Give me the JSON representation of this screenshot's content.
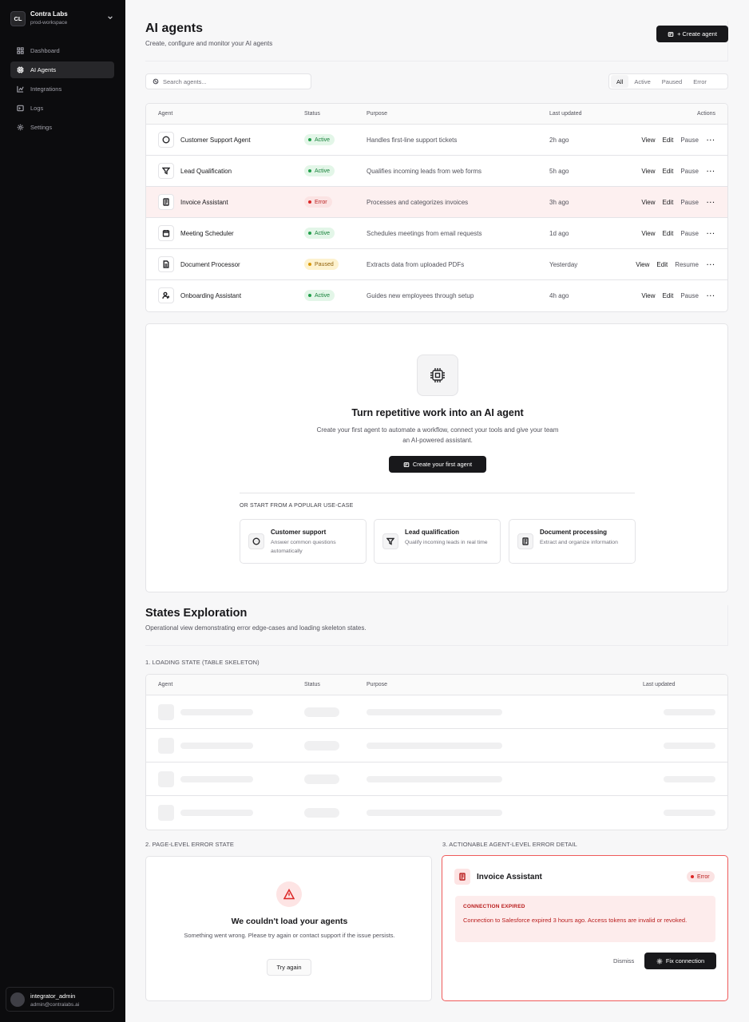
{
  "workspace": {
    "initials": "CL",
    "name": "Contra Labs",
    "subtitle": "prod-workspace"
  },
  "nav": [
    {
      "label": "Dashboard",
      "icon": "grid-icon"
    },
    {
      "label": "AI Agents",
      "icon": "chip-icon",
      "active": true
    },
    {
      "label": "Integrations",
      "icon": "chart-icon"
    },
    {
      "label": "Logs",
      "icon": "terminal-icon"
    },
    {
      "label": "Settings",
      "icon": "gear-icon"
    }
  ],
  "user": {
    "name": "integrator_admin",
    "email": "admin@contralabs.ai"
  },
  "header": {
    "title": "AI agents",
    "subtitle": "Create, configure and monitor your AI agents",
    "create_label": "+ Create agent"
  },
  "search": {
    "placeholder": "Search agents..."
  },
  "filters": [
    "All",
    "Active",
    "Paused",
    "Error"
  ],
  "table": {
    "columns": [
      "Agent",
      "Status",
      "Purpose",
      "Last updated",
      "Actions"
    ],
    "rows": [
      {
        "name": "Customer Support Agent",
        "icon": "chat-icon",
        "status": "Active",
        "purpose": "Handles first-line support tickets",
        "updated": "2h ago",
        "actions": [
          "View",
          "Edit",
          "Pause"
        ]
      },
      {
        "name": "Lead Qualification",
        "icon": "funnel-icon",
        "status": "Active",
        "purpose": "Qualifies incoming leads from web forms",
        "updated": "5h ago",
        "actions": [
          "View",
          "Edit",
          "Pause"
        ]
      },
      {
        "name": "Invoice Assistant",
        "icon": "invoice-icon",
        "status": "Error",
        "purpose": "Processes and categorizes invoices",
        "updated": "3h ago",
        "actions": [
          "View",
          "Edit",
          "Pause"
        ]
      },
      {
        "name": "Meeting Scheduler",
        "icon": "calendar-icon",
        "status": "Active",
        "purpose": "Schedules meetings from email requests",
        "updated": "1d ago",
        "actions": [
          "View",
          "Edit",
          "Pause"
        ]
      },
      {
        "name": "Document Processor",
        "icon": "document-icon",
        "status": "Paused",
        "purpose": "Extracts data from uploaded PDFs",
        "updated": "Yesterday",
        "actions": [
          "View",
          "Edit",
          "Resume"
        ]
      },
      {
        "name": "Onboarding Assistant",
        "icon": "user-plus-icon",
        "status": "Active",
        "purpose": "Guides new employees through setup",
        "updated": "4h ago",
        "actions": [
          "View",
          "Edit",
          "Pause"
        ]
      }
    ]
  },
  "empty_state": {
    "title": "Turn repetitive work into an AI agent",
    "description": "Create your first agent to automate a workflow, connect your tools and give your team an AI-powered assistant.",
    "button": "Create your first agent",
    "or_label": "OR START FROM A POPULAR USE-CASE",
    "use_cases": [
      {
        "title": "Customer support",
        "description": "Answer common questions automatically",
        "icon": "chat-icon"
      },
      {
        "title": "Lead qualification",
        "description": "Qualify incoming leads in real time",
        "icon": "funnel-icon"
      },
      {
        "title": "Document processing",
        "description": "Extract and organize information",
        "icon": "invoice-icon"
      }
    ]
  },
  "states": {
    "title": "States Exploration",
    "subtitle": "Operational view demonstrating error edge-cases and loading skeleton states.",
    "loading_label": "1. LOADING STATE (TABLE SKELETON)",
    "skeleton_columns": [
      "Agent",
      "Status",
      "Purpose",
      "Last updated"
    ],
    "page_error_label": "2. PAGE-LEVEL ERROR STATE",
    "agent_error_label": "3. ACTIONABLE AGENT-LEVEL ERROR DETAIL"
  },
  "page_error": {
    "title": "We couldn't load your agents",
    "description": "Something went wrong. Please try again or contact support if the issue persists.",
    "button": "Try again"
  },
  "agent_error": {
    "name": "Invoice Assistant",
    "status": "Error",
    "box_title": "CONNECTION EXPIRED",
    "box_description": "Connection to Salesforce expired 3 hours ago. Access tokens are invalid or revoked.",
    "dismiss": "Dismiss",
    "fix": "Fix connection"
  },
  "colors": {
    "sidebar": "#0c0c0e",
    "accent_dark": "#18181b",
    "active": "#16803a",
    "error": "#b91c1c",
    "paused": "#92620a"
  }
}
